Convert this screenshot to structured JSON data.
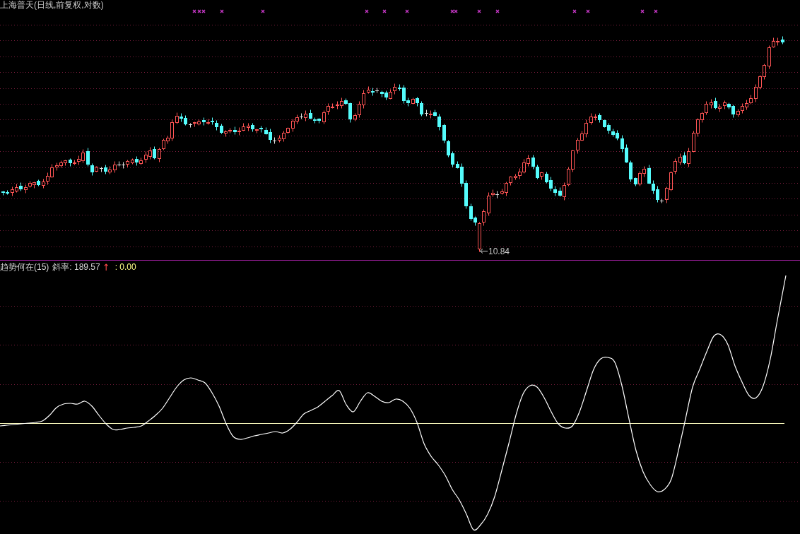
{
  "title": "上海普天(日线,前复权,对数)",
  "price_panel": {
    "low_price": "10.84"
  },
  "indicator_panel": {
    "name": "趋势何在(15)",
    "slope_reading": "斜率: 189.57",
    "slope_arrow": "↑",
    "reading_2": ": 0.00"
  }
}
